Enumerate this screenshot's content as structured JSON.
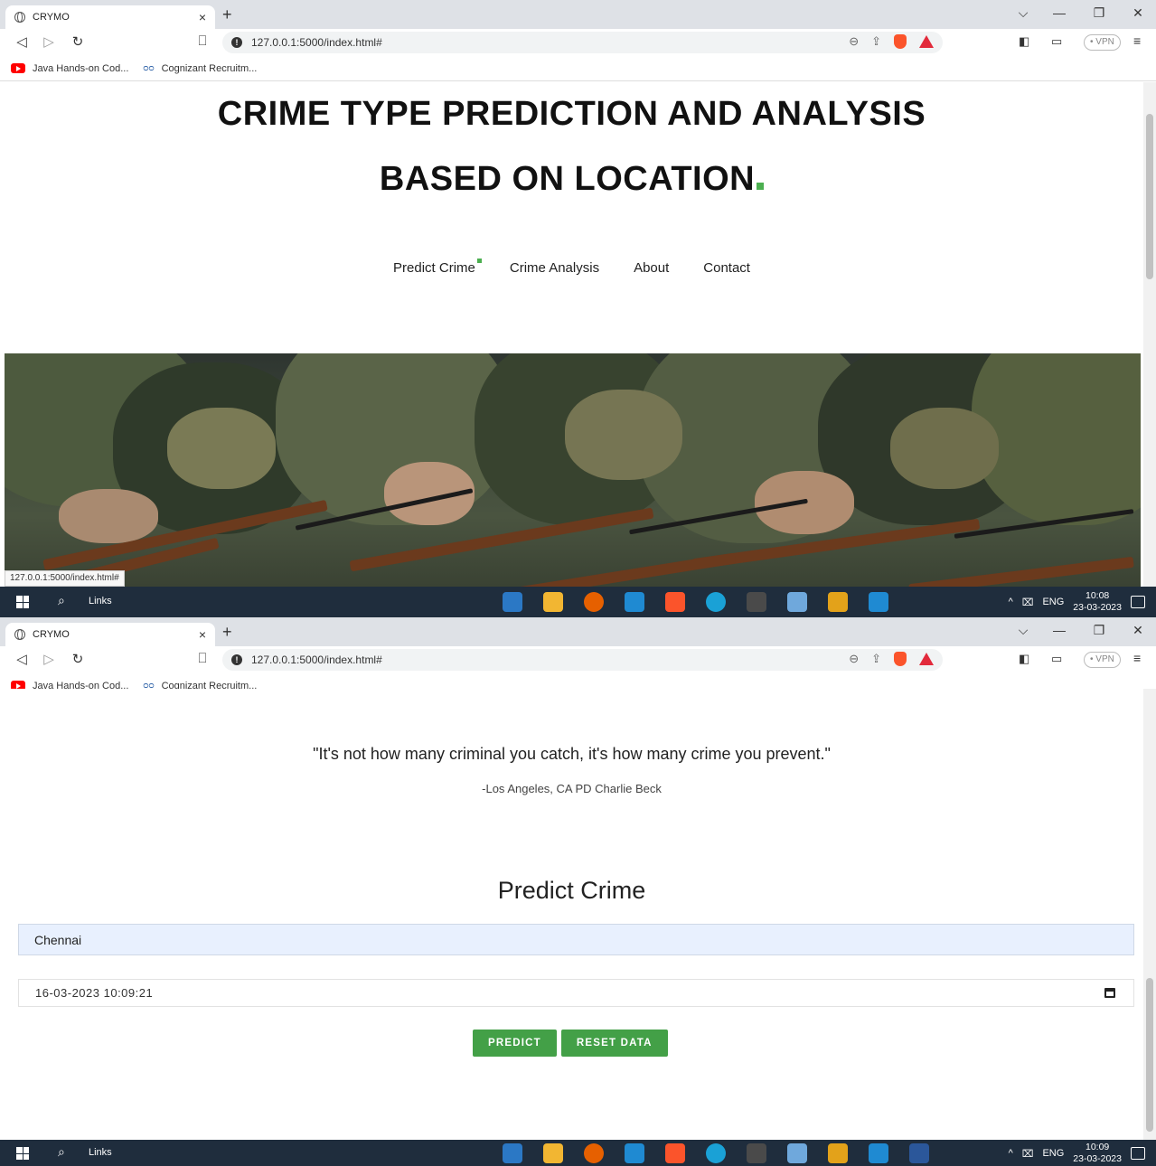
{
  "browser": {
    "tab_title": "CRYMO",
    "tab_close": "×",
    "new_tab": "+",
    "url": "127.0.0.1:5000/index.html#",
    "vpn_label": "• VPN",
    "bookmarks": [
      {
        "label": "Java Hands-on Cod..."
      },
      {
        "label": "Cognizant Recruitm..."
      }
    ],
    "status_url": "127.0.0.1:5000/index.html#"
  },
  "header": {
    "title_line1": "CRIME TYPE PREDICTION AND ANALYSIS",
    "title_line2": "BASED ON LOCATION"
  },
  "nav": {
    "items": [
      {
        "label": "Predict Crime"
      },
      {
        "label": "Crime Analysis"
      },
      {
        "label": "About"
      },
      {
        "label": "Contact"
      }
    ]
  },
  "quote": {
    "text": "\"It's not how many criminal you catch, it's how many crime you prevent.\"",
    "author": "-Los Angeles, CA PD Charlie Beck"
  },
  "predict": {
    "title": "Predict Crime",
    "city_value": "Chennai",
    "datetime_value": "16-03-2023 10:09:21",
    "predict_label": "PREDICT",
    "reset_label": "RESET DATA"
  },
  "taskbar": {
    "search_label": "Links",
    "lang": "ENG",
    "shot1_time": "10:08",
    "shot1_date": "23-03-2023",
    "shot2_time": "10:09",
    "shot2_date": "23-03-2023"
  },
  "colors": {
    "accent_green": "#43a047",
    "input_fill": "#e8f0fe",
    "taskbar": "#1f2d3d"
  }
}
